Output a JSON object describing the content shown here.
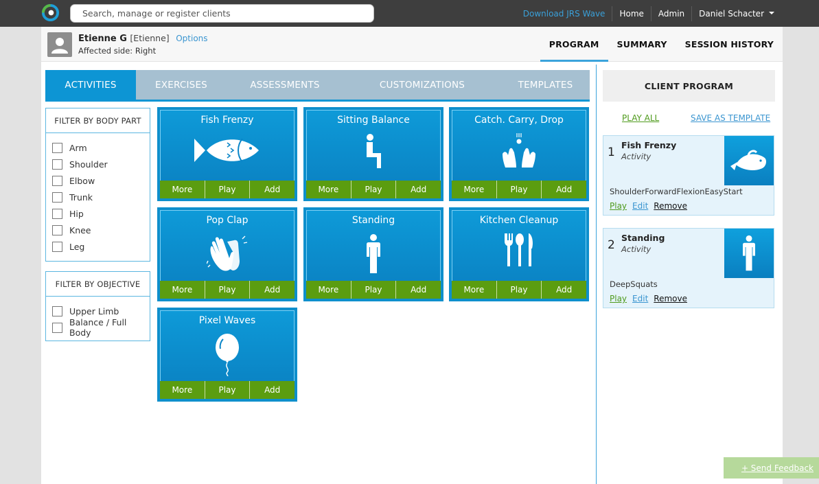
{
  "search": {
    "placeholder": "Search, manage or register clients"
  },
  "topnav": {
    "download": "Download JRS Wave",
    "home": "Home",
    "admin": "Admin",
    "user": "Daniel Schacter"
  },
  "client": {
    "name": "Etienne G",
    "nickname": "[Etienne]",
    "options": "Options",
    "affected_side": "Affected side: Right"
  },
  "program_tabs": [
    "PROGRAM",
    "SUMMARY",
    "SESSION HISTORY"
  ],
  "category_tabs": [
    "ACTIVITIES",
    "EXERCISES",
    "ASSESSMENTS",
    "CUSTOMIZATIONS",
    "TEMPLATES"
  ],
  "filter_body": {
    "title": "FILTER BY BODY PART",
    "items": [
      "Arm",
      "Shoulder",
      "Elbow",
      "Trunk",
      "Hip",
      "Knee",
      "Leg"
    ]
  },
  "filter_objective": {
    "title": "FILTER BY OBJECTIVE",
    "items": [
      "Upper Limb",
      "Balance / Full Body"
    ]
  },
  "card_buttons": {
    "more": "More",
    "play": "Play",
    "add": "Add"
  },
  "activities": [
    {
      "title": "Fish Frenzy",
      "icon": "fish-icon"
    },
    {
      "title": "Sitting Balance",
      "icon": "sitting-person-icon"
    },
    {
      "title": "Catch. Carry, Drop",
      "icon": "hands-catch-icon"
    },
    {
      "title": "Pop Clap",
      "icon": "clapping-hands-icon"
    },
    {
      "title": "Standing",
      "icon": "standing-person-icon"
    },
    {
      "title": "Kitchen Cleanup",
      "icon": "cutlery-icon"
    },
    {
      "title": "Pixel Waves",
      "icon": "balloon-icon"
    }
  ],
  "client_program": {
    "title": "CLIENT PROGRAM",
    "play_all": "PLAY ALL",
    "save_template": "SAVE AS TEMPLATE",
    "items": [
      {
        "num": "1",
        "name": "Fish Frenzy",
        "type": "Activity",
        "config": "ShoulderForwardFlexionEasyStart",
        "icon": "fish-icon"
      },
      {
        "num": "2",
        "name": "Standing",
        "type": "Activity",
        "config": "DeepSquats",
        "icon": "standing-person-icon"
      }
    ],
    "links": {
      "play": "Play",
      "edit": "Edit",
      "remove": "Remove"
    }
  },
  "feedback": "+ Send Feedback",
  "colors": {
    "accent": "#0d95d4",
    "button_green": "#5b9d10",
    "topbar": "#3e3e3e"
  }
}
